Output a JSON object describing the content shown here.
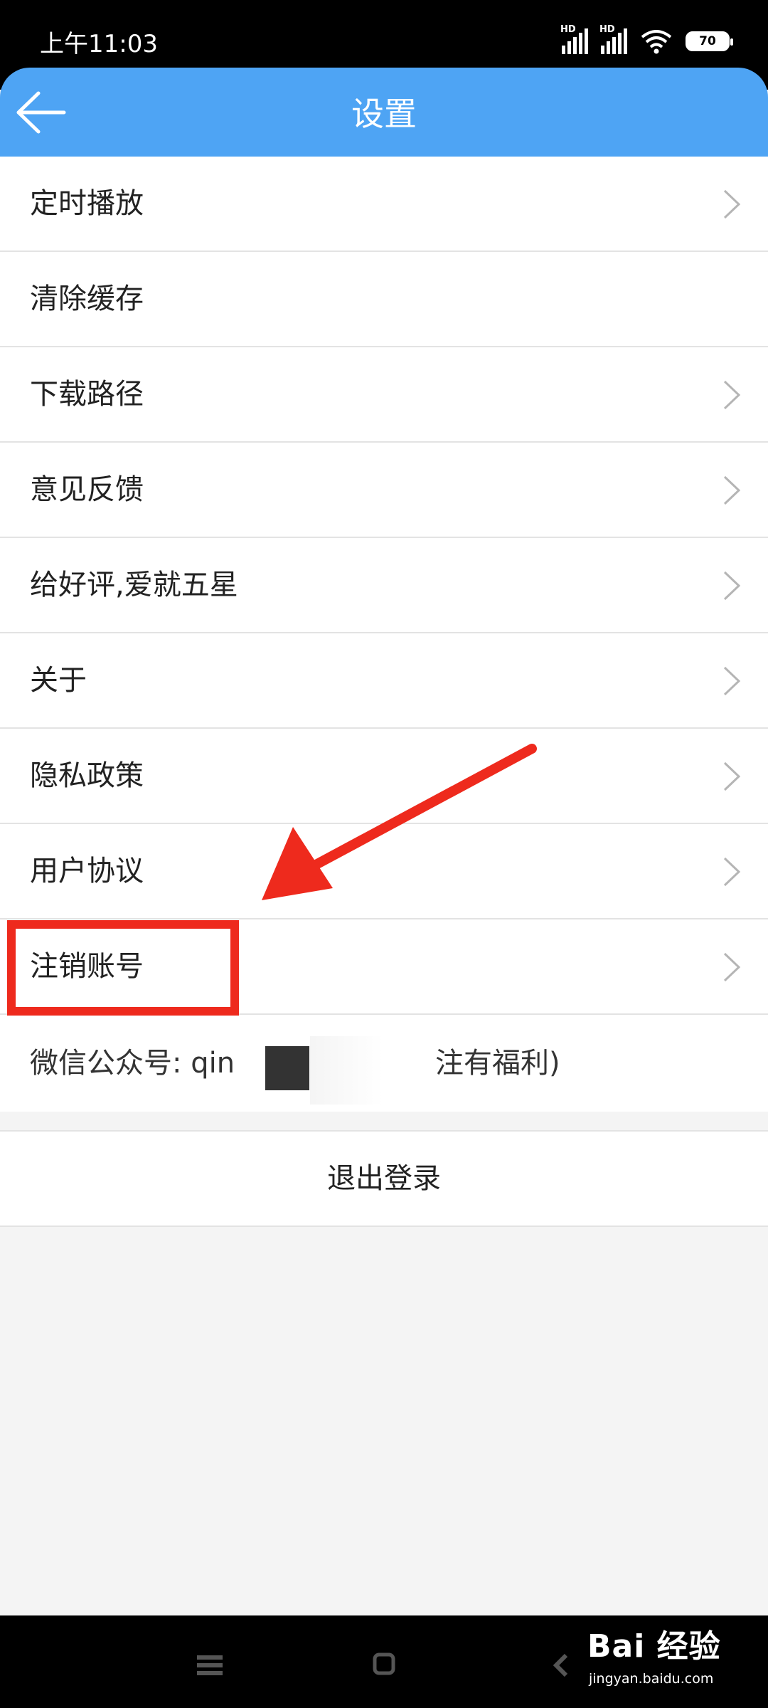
{
  "status_bar": {
    "time": "上午11:03",
    "signal_badge": "HD",
    "battery": "70"
  },
  "header": {
    "title": "设置"
  },
  "settings": {
    "items": [
      {
        "label": "定时播放"
      },
      {
        "label": "清除缓存"
      },
      {
        "label": "下载路径"
      },
      {
        "label": "意见反馈"
      },
      {
        "label": "给好评,爱就五星"
      },
      {
        "label": "关于"
      },
      {
        "label": "隐私政策"
      },
      {
        "label": "用户协议"
      },
      {
        "label": "注销账号"
      }
    ],
    "wechat_prefix": "微信公众号: qin",
    "wechat_suffix": "注有福利)"
  },
  "logout": {
    "label": "退出登录"
  },
  "watermark": {
    "logo": "Bai 经验",
    "url": "jingyan.baidu.com"
  },
  "colors": {
    "header": "#4ea4f4",
    "highlight": "#ee2a1d"
  },
  "icons": {
    "back": "arrow-left-icon",
    "chevron": "chevron-right-icon"
  }
}
